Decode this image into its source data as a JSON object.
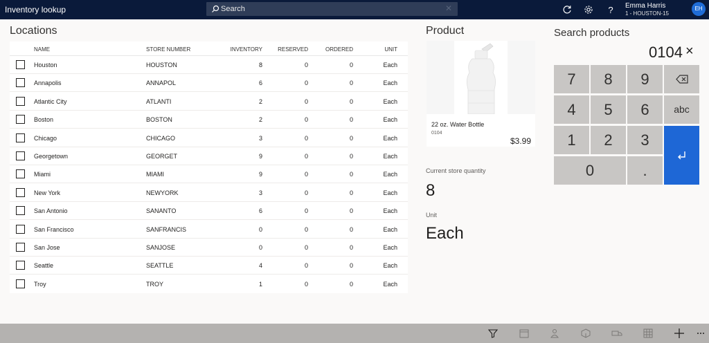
{
  "header": {
    "app_title": "Inventory lookup",
    "search_placeholder": "Search",
    "user_name": "Emma Harris",
    "user_store": "1 - HOUSTON-15",
    "user_initials": "EH"
  },
  "locations": {
    "title": "Locations",
    "columns": {
      "name": "NAME",
      "store_number": "STORE NUMBER",
      "inventory": "INVENTORY",
      "reserved": "RESERVED",
      "ordered": "ORDERED",
      "unit": "UNIT"
    },
    "rows": [
      {
        "name": "Houston",
        "store": "HOUSTON",
        "inventory": "8",
        "reserved": "0",
        "ordered": "0",
        "unit": "Each"
      },
      {
        "name": "Annapolis",
        "store": "ANNAPOL",
        "inventory": "6",
        "reserved": "0",
        "ordered": "0",
        "unit": "Each"
      },
      {
        "name": "Atlantic City",
        "store": "ATLANTI",
        "inventory": "2",
        "reserved": "0",
        "ordered": "0",
        "unit": "Each"
      },
      {
        "name": "Boston",
        "store": "BOSTON",
        "inventory": "2",
        "reserved": "0",
        "ordered": "0",
        "unit": "Each"
      },
      {
        "name": "Chicago",
        "store": "CHICAGO",
        "inventory": "3",
        "reserved": "0",
        "ordered": "0",
        "unit": "Each"
      },
      {
        "name": "Georgetown",
        "store": "GEORGET",
        "inventory": "9",
        "reserved": "0",
        "ordered": "0",
        "unit": "Each"
      },
      {
        "name": "Miami",
        "store": "MIAMI",
        "inventory": "9",
        "reserved": "0",
        "ordered": "0",
        "unit": "Each"
      },
      {
        "name": "New York",
        "store": "NEWYORK",
        "inventory": "3",
        "reserved": "0",
        "ordered": "0",
        "unit": "Each"
      },
      {
        "name": "San Antonio",
        "store": "SANANTO",
        "inventory": "6",
        "reserved": "0",
        "ordered": "0",
        "unit": "Each"
      },
      {
        "name": "San Francisco",
        "store": "SANFRANCIS",
        "inventory": "0",
        "reserved": "0",
        "ordered": "0",
        "unit": "Each"
      },
      {
        "name": "San Jose",
        "store": "SANJOSE",
        "inventory": "0",
        "reserved": "0",
        "ordered": "0",
        "unit": "Each"
      },
      {
        "name": "Seattle",
        "store": "SEATTLE",
        "inventory": "4",
        "reserved": "0",
        "ordered": "0",
        "unit": "Each"
      },
      {
        "name": "Troy",
        "store": "TROY",
        "inventory": "1",
        "reserved": "0",
        "ordered": "0",
        "unit": "Each"
      }
    ]
  },
  "product": {
    "title": "Product",
    "name": "22 oz. Water Bottle",
    "id": "0104",
    "price": "$3.99",
    "store_qty_label": "Current store quantity",
    "store_qty": "8",
    "unit_label": "Unit",
    "unit": "Each"
  },
  "search_products": {
    "title": "Search products",
    "value": "0104",
    "keys": {
      "k7": "7",
      "k8": "8",
      "k9": "9",
      "k4": "4",
      "k5": "5",
      "k6": "6",
      "abc": "abc",
      "k1": "1",
      "k2": "2",
      "k3": "3",
      "k0": "0",
      "dot": "."
    }
  },
  "icons": {
    "top": [
      "search-icon",
      "refresh-icon",
      "gear-icon",
      "help-icon"
    ],
    "bottom": [
      "filter-icon",
      "calendar-icon",
      "person-icon",
      "package-icon",
      "truck-icon",
      "grid-icon",
      "plus-icon",
      "more-icon"
    ]
  },
  "colors": {
    "header_bg": "#0a1a3a",
    "accent": "#1e67d6",
    "key_bg": "#c8c6c4",
    "bottom_bar": "#b4b2b0"
  }
}
